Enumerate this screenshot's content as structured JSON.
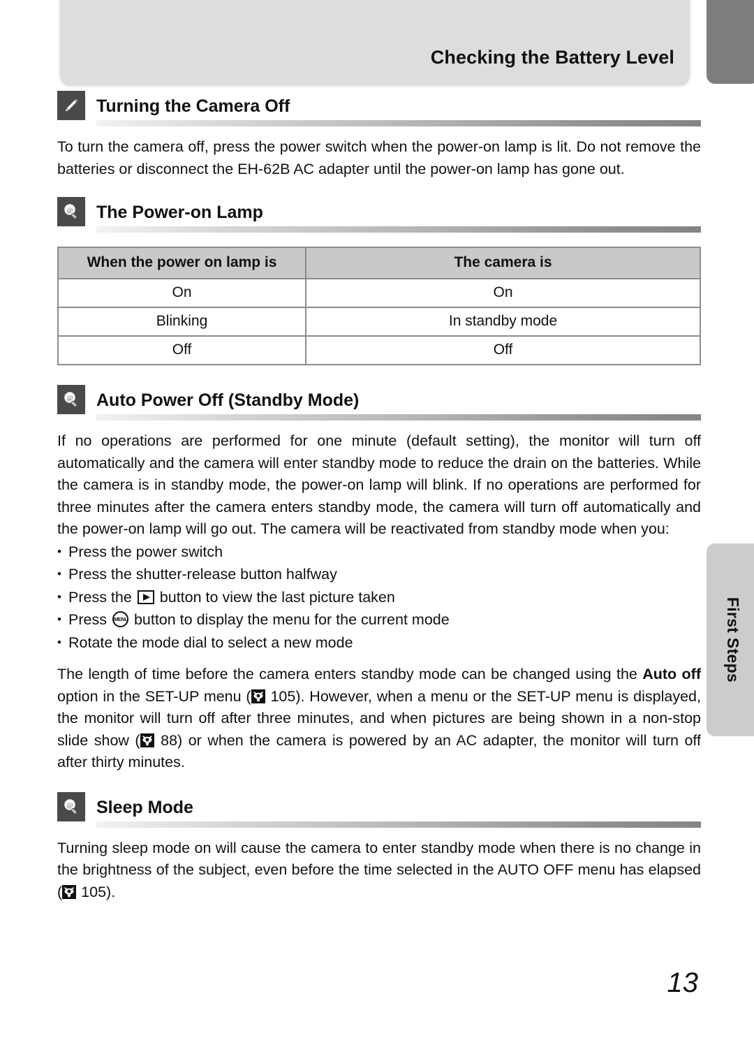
{
  "header": {
    "title": "Checking the Battery Level"
  },
  "side_tabs": {
    "top_tab_label": "",
    "side_tab_label": "First Steps"
  },
  "sections": [
    {
      "icon": "pencil-icon",
      "title": "Turning the Camera Off",
      "paragraph": "To turn the camera off, press the power switch when the power-on lamp is lit. Do not remove the batteries or disconnect the EH-62B AC adapter until the power-on lamp has gone out."
    },
    {
      "icon": "lightbulb-icon",
      "title": "The Power-on Lamp"
    },
    {
      "icon": "lightbulb-icon",
      "title": "Auto Power Off (Standby Mode)",
      "paragraph": "If no operations are performed for one minute (default setting), the monitor will turn off automatically and the camera will enter standby mode to reduce the drain on the batteries. While the camera is in standby mode, the power-on lamp will blink. If no operations are performed for three minutes after the camera enters standby mode, the camera will turn off automatically and the power-on lamp will go out. The camera will be reactivated from standby mode when you:"
    },
    {
      "icon": "lightbulb-icon",
      "title": "Sleep Mode"
    }
  ],
  "lamp_table": {
    "headers": [
      "When the power on lamp is",
      "The camera is"
    ],
    "rows": [
      [
        "On",
        "On"
      ],
      [
        "Blinking",
        "In standby mode"
      ],
      [
        "Off",
        "Off"
      ]
    ]
  },
  "standby_bullets": {
    "b1": "Press the power switch",
    "b2": "Press the shutter-release button halfway",
    "b3_pre": "Press the",
    "b3_post": "button to view the last picture taken",
    "b4_pre": "Press",
    "b4_post": "button to display the menu for the current mode",
    "b5": "Rotate the mode dial to select a new mode"
  },
  "auto_off_paragraph": {
    "t1": "The length of time before the camera enters standby mode can be changed using the ",
    "bold1": "Auto off",
    "t2": " option in the SET-UP menu (",
    "ref1": "105",
    "t3": "). However, when a menu or the SET-UP menu is displayed, the monitor will turn off after three minutes, and when pictures are being shown in a non-stop slide show (",
    "ref2": "88",
    "t4": ") or when the camera is powered by an AC adapter, the monitor will turn off after thirty minutes."
  },
  "sleep_paragraph": {
    "t1": "Turning sleep mode on will cause the camera to enter standby mode when there is no change in the brightness of the subject, even before the time selected in the AUTO OFF menu has elapsed (",
    "ref1": "105",
    "t2": ")."
  },
  "footer": {
    "page_number": "13"
  },
  "colors": {
    "header_band": "#dcdddf",
    "tab_dark": "#7d7d7d",
    "tab_light": "#cccccc",
    "icon_box": "#4a4a4a",
    "table_header": "#c9c9c9",
    "table_border": "#8c8c8c"
  }
}
